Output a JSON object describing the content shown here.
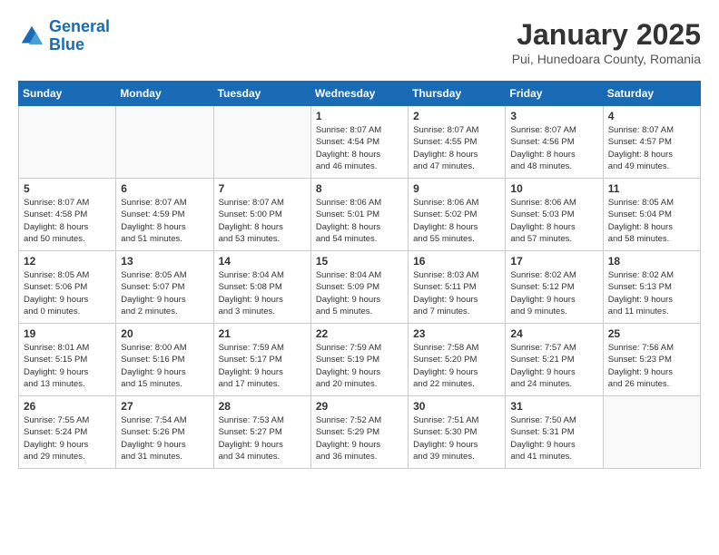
{
  "header": {
    "logo_line1": "General",
    "logo_line2": "Blue",
    "month": "January 2025",
    "location": "Pui, Hunedoara County, Romania"
  },
  "weekdays": [
    "Sunday",
    "Monday",
    "Tuesday",
    "Wednesday",
    "Thursday",
    "Friday",
    "Saturday"
  ],
  "weeks": [
    [
      {
        "day": "",
        "info": ""
      },
      {
        "day": "",
        "info": ""
      },
      {
        "day": "",
        "info": ""
      },
      {
        "day": "1",
        "info": "Sunrise: 8:07 AM\nSunset: 4:54 PM\nDaylight: 8 hours\nand 46 minutes."
      },
      {
        "day": "2",
        "info": "Sunrise: 8:07 AM\nSunset: 4:55 PM\nDaylight: 8 hours\nand 47 minutes."
      },
      {
        "day": "3",
        "info": "Sunrise: 8:07 AM\nSunset: 4:56 PM\nDaylight: 8 hours\nand 48 minutes."
      },
      {
        "day": "4",
        "info": "Sunrise: 8:07 AM\nSunset: 4:57 PM\nDaylight: 8 hours\nand 49 minutes."
      }
    ],
    [
      {
        "day": "5",
        "info": "Sunrise: 8:07 AM\nSunset: 4:58 PM\nDaylight: 8 hours\nand 50 minutes."
      },
      {
        "day": "6",
        "info": "Sunrise: 8:07 AM\nSunset: 4:59 PM\nDaylight: 8 hours\nand 51 minutes."
      },
      {
        "day": "7",
        "info": "Sunrise: 8:07 AM\nSunset: 5:00 PM\nDaylight: 8 hours\nand 53 minutes."
      },
      {
        "day": "8",
        "info": "Sunrise: 8:06 AM\nSunset: 5:01 PM\nDaylight: 8 hours\nand 54 minutes."
      },
      {
        "day": "9",
        "info": "Sunrise: 8:06 AM\nSunset: 5:02 PM\nDaylight: 8 hours\nand 55 minutes."
      },
      {
        "day": "10",
        "info": "Sunrise: 8:06 AM\nSunset: 5:03 PM\nDaylight: 8 hours\nand 57 minutes."
      },
      {
        "day": "11",
        "info": "Sunrise: 8:05 AM\nSunset: 5:04 PM\nDaylight: 8 hours\nand 58 minutes."
      }
    ],
    [
      {
        "day": "12",
        "info": "Sunrise: 8:05 AM\nSunset: 5:06 PM\nDaylight: 9 hours\nand 0 minutes."
      },
      {
        "day": "13",
        "info": "Sunrise: 8:05 AM\nSunset: 5:07 PM\nDaylight: 9 hours\nand 2 minutes."
      },
      {
        "day": "14",
        "info": "Sunrise: 8:04 AM\nSunset: 5:08 PM\nDaylight: 9 hours\nand 3 minutes."
      },
      {
        "day": "15",
        "info": "Sunrise: 8:04 AM\nSunset: 5:09 PM\nDaylight: 9 hours\nand 5 minutes."
      },
      {
        "day": "16",
        "info": "Sunrise: 8:03 AM\nSunset: 5:11 PM\nDaylight: 9 hours\nand 7 minutes."
      },
      {
        "day": "17",
        "info": "Sunrise: 8:02 AM\nSunset: 5:12 PM\nDaylight: 9 hours\nand 9 minutes."
      },
      {
        "day": "18",
        "info": "Sunrise: 8:02 AM\nSunset: 5:13 PM\nDaylight: 9 hours\nand 11 minutes."
      }
    ],
    [
      {
        "day": "19",
        "info": "Sunrise: 8:01 AM\nSunset: 5:15 PM\nDaylight: 9 hours\nand 13 minutes."
      },
      {
        "day": "20",
        "info": "Sunrise: 8:00 AM\nSunset: 5:16 PM\nDaylight: 9 hours\nand 15 minutes."
      },
      {
        "day": "21",
        "info": "Sunrise: 7:59 AM\nSunset: 5:17 PM\nDaylight: 9 hours\nand 17 minutes."
      },
      {
        "day": "22",
        "info": "Sunrise: 7:59 AM\nSunset: 5:19 PM\nDaylight: 9 hours\nand 20 minutes."
      },
      {
        "day": "23",
        "info": "Sunrise: 7:58 AM\nSunset: 5:20 PM\nDaylight: 9 hours\nand 22 minutes."
      },
      {
        "day": "24",
        "info": "Sunrise: 7:57 AM\nSunset: 5:21 PM\nDaylight: 9 hours\nand 24 minutes."
      },
      {
        "day": "25",
        "info": "Sunrise: 7:56 AM\nSunset: 5:23 PM\nDaylight: 9 hours\nand 26 minutes."
      }
    ],
    [
      {
        "day": "26",
        "info": "Sunrise: 7:55 AM\nSunset: 5:24 PM\nDaylight: 9 hours\nand 29 minutes."
      },
      {
        "day": "27",
        "info": "Sunrise: 7:54 AM\nSunset: 5:26 PM\nDaylight: 9 hours\nand 31 minutes."
      },
      {
        "day": "28",
        "info": "Sunrise: 7:53 AM\nSunset: 5:27 PM\nDaylight: 9 hours\nand 34 minutes."
      },
      {
        "day": "29",
        "info": "Sunrise: 7:52 AM\nSunset: 5:29 PM\nDaylight: 9 hours\nand 36 minutes."
      },
      {
        "day": "30",
        "info": "Sunrise: 7:51 AM\nSunset: 5:30 PM\nDaylight: 9 hours\nand 39 minutes."
      },
      {
        "day": "31",
        "info": "Sunrise: 7:50 AM\nSunset: 5:31 PM\nDaylight: 9 hours\nand 41 minutes."
      },
      {
        "day": "",
        "info": ""
      }
    ]
  ]
}
